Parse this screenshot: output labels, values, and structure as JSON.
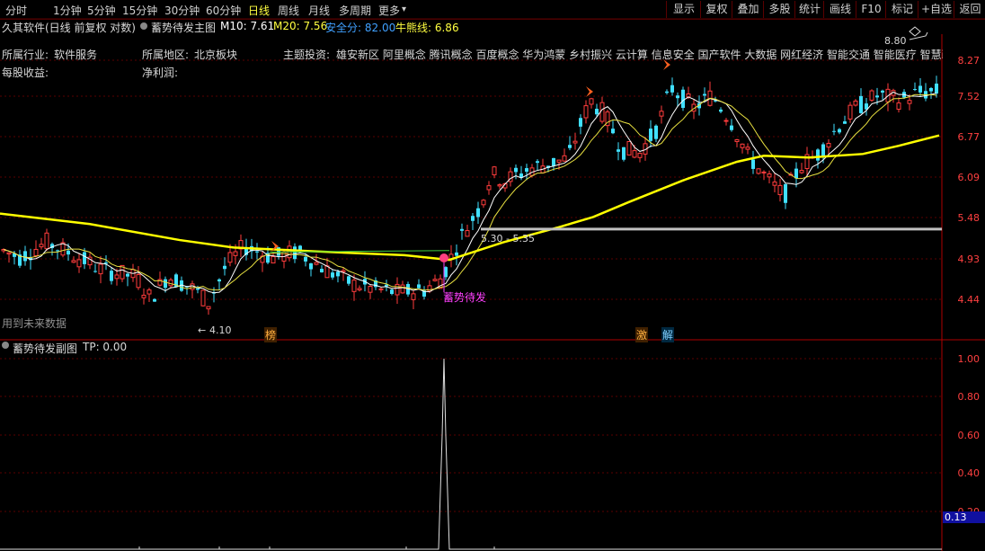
{
  "periods": [
    "分时",
    "1分钟",
    "5分钟",
    "15分钟",
    "30分钟",
    "60分钟",
    "日线",
    "周线",
    "月线",
    "多周期",
    "更多"
  ],
  "active_period": "日线",
  "more_arrow": "▾",
  "right_buttons": [
    "显示",
    "复权",
    "叠加",
    "多股",
    "统计",
    "画线",
    "F10",
    "标记",
    "+自选",
    "返回"
  ],
  "main": {
    "title": "久其软件(日线 前复权 对数)",
    "indicator_name": "蓄势待发主图",
    "ma10": "M10: 7.61",
    "ma20": "M20: 7.56",
    "safety": "安全分: 82.00",
    "bull_line": "牛熊线: 6.86",
    "colors": {
      "ma10": "#ffffff",
      "ma20": "#ffff40",
      "safety": "#40a0ff",
      "bull_line": "#ffff40"
    }
  },
  "stock_info": {
    "industry_label": "所属行业:",
    "industry": "软件服务",
    "region_label": "所属地区:",
    "region": "北京板块",
    "theme_label": "主题投资:",
    "themes": "雄安新区 阿里概念 腾讯概念 百度概念 华为鸿蒙 乡村振兴 云计算 信息安全 国产软件 大数据 网红经济 智能交通 智能医疗 智慧政",
    "eps_label": "每股收益:",
    "profit_label": "净利润:"
  },
  "price_axis": [
    "8.27",
    "7.52",
    "6.77",
    "6.09",
    "5.48",
    "4.93",
    "4.44"
  ],
  "annotations": {
    "high": "8.80",
    "low": "4.10",
    "low_prefix": "←",
    "range": "5.30 - 5.35",
    "signal": "蓄势待发",
    "future_data": "用到未来数据",
    "tag1": "榜",
    "tag2": "激",
    "tag3": "解"
  },
  "sub": {
    "indicator_name": "蓄势待发副图",
    "tp": "TP: 0.00",
    "axis": [
      "1.00",
      "0.80",
      "0.60",
      "0.40",
      "0.20"
    ],
    "current_value": "0.13"
  },
  "chart_data": {
    "type": "candlestick",
    "scale": "log",
    "price_range": [
      4.1,
      8.8
    ],
    "price_ticks": [
      8.27,
      7.52,
      6.77,
      6.09,
      5.48,
      4.93,
      4.44
    ],
    "sub_type": "line",
    "sub_range": [
      0,
      1.05
    ],
    "sub_ticks": [
      1.0,
      0.8,
      0.6,
      0.4,
      0.2
    ]
  }
}
